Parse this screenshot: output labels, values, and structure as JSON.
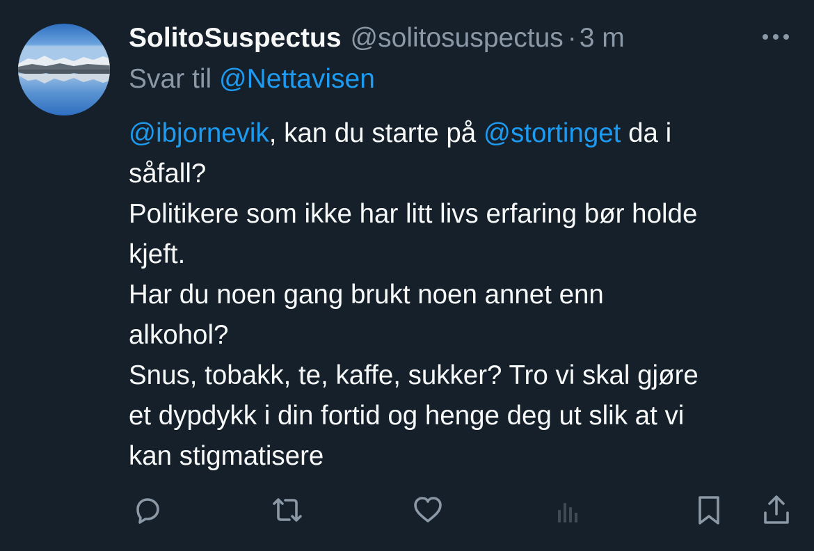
{
  "tweet": {
    "display_name": "SolitoSuspectus",
    "handle": "@solitosuspectus",
    "separator": "·",
    "time": "3 m",
    "reply_prefix": "Svar til",
    "reply_mention": "@Nettavisen",
    "text": {
      "mention_1": "@ibjornevik",
      "text_1": ", kan du starte på ",
      "mention_2": "@stortinget",
      "text_2": " da i",
      "line_2": "såfall?",
      "line_3": "Politikere som ikke har litt livs erfaring bør holde",
      "line_4": "kjeft.",
      "line_5": "Har du noen gang brukt noen annet enn",
      "line_6": "alkohol?",
      "line_7": "Snus, tobakk, te, kaffe, sukker? Tro vi skal gjøre",
      "line_8": "et dypdykk i din fortid og henge deg ut slik at vi",
      "line_9": "kan stigmatisere"
    }
  },
  "icons": {
    "more": "more-icon",
    "reply": "reply-icon",
    "retweet": "retweet-icon",
    "like": "heart-icon",
    "views": "views-icon",
    "bookmark": "bookmark-icon",
    "share": "share-icon"
  },
  "colors": {
    "background": "#15202b",
    "text_primary": "#f7f9f9",
    "text_secondary": "#8b98a5",
    "link": "#1d9bf0",
    "views_icon_dim": "#3f4a55"
  }
}
